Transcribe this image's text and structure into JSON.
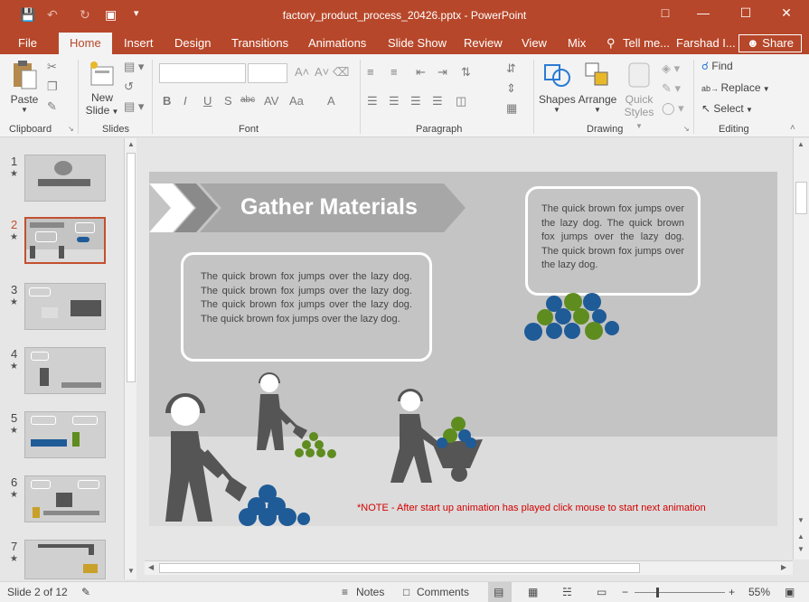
{
  "window": {
    "title": "factory_product_process_20426.pptx - PowerPoint"
  },
  "tabs": [
    "File",
    "Home",
    "Insert",
    "Design",
    "Transitions",
    "Animations",
    "Slide Show",
    "Review",
    "View",
    "Mix"
  ],
  "tell_me": "Tell me...",
  "user": "Farshad I...",
  "share_label": "Share",
  "ribbon": {
    "paste": "Paste",
    "new_slide_1": "New",
    "new_slide_2": "Slide",
    "shapes": "Shapes",
    "arrange": "Arrange",
    "quick_styles_1": "Quick",
    "quick_styles_2": "Styles",
    "find": "Find",
    "replace": "Replace",
    "select": "Select",
    "groups": {
      "clipboard": "Clipboard",
      "slides": "Slides",
      "font": "Font",
      "paragraph": "Paragraph",
      "drawing": "Drawing",
      "editing": "Editing"
    }
  },
  "thumbnails": [
    {
      "num": "1",
      "star": "★"
    },
    {
      "num": "2",
      "star": "★"
    },
    {
      "num": "3",
      "star": "★"
    },
    {
      "num": "4",
      "star": "★"
    },
    {
      "num": "5",
      "star": "★"
    },
    {
      "num": "6",
      "star": "★"
    },
    {
      "num": "7",
      "star": "★"
    }
  ],
  "slide": {
    "heading": "Gather Materials",
    "bubble_left": "The quick brown fox jumps over the lazy dog. The quick brown fox jumps over the lazy dog.  The quick brown fox jumps over the lazy dog. The quick brown fox jumps over the lazy dog.",
    "bubble_right": "The quick brown fox jumps over the lazy dog. The quick brown fox jumps over the lazy dog.  The quick brown fox jumps over the lazy dog.",
    "note": "*NOTE - After start up animation has played click mouse to start next animation"
  },
  "status": {
    "slide_info": "Slide 2 of 12",
    "notes": "Notes",
    "comments": "Comments",
    "zoom": "55%"
  },
  "colors": {
    "accent": "#b7472a",
    "ball_blue": "#1f5b97",
    "ball_green": "#5f8c1f",
    "figure": "#555555"
  }
}
